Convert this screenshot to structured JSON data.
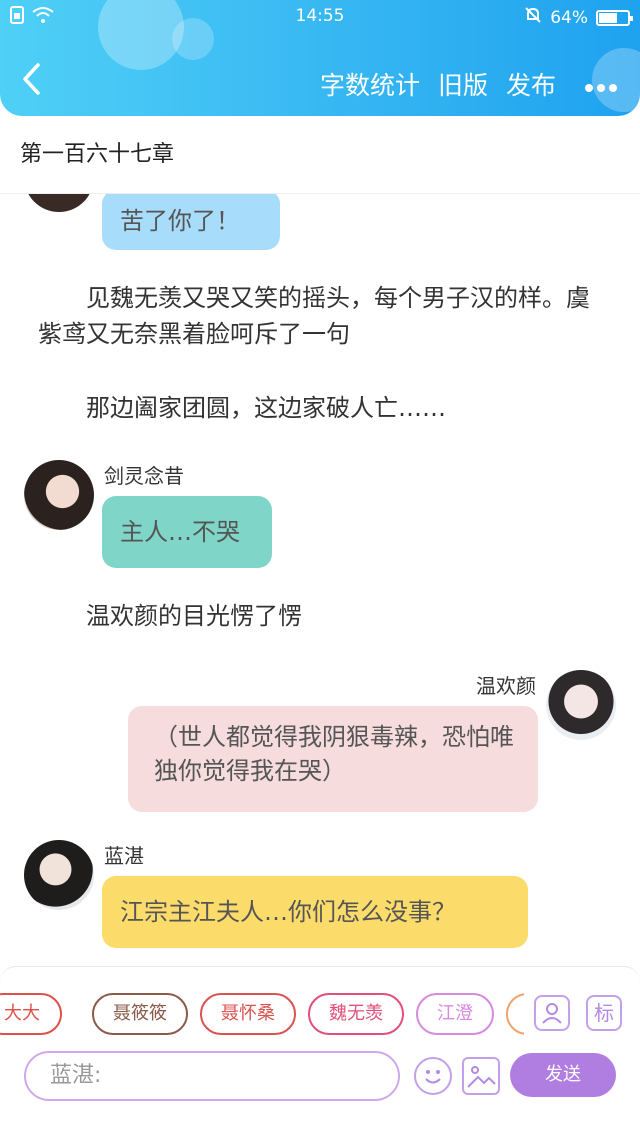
{
  "status_bar": {
    "time": "14:55",
    "battery": "64%",
    "battery_level": 0.64,
    "icons": [
      "sim-icon",
      "wifi-icon",
      "mute-bell-icon",
      "battery-icon"
    ]
  },
  "nav": {
    "back_icon": "chevron-left-icon",
    "word_count": "字数统计",
    "old_version": "旧版",
    "publish": "发布",
    "more_icon": "more-dots-icon"
  },
  "chapter": {
    "title": "第一百六十七章"
  },
  "messages": [
    {
      "type": "bubble",
      "side": "left",
      "speaker": "",
      "text": "苦了你了！",
      "color": "#a8dcfb"
    },
    {
      "type": "narration",
      "text": "见魏无羡又哭又笑的摇头，每个男子汉的样。虞紫鸢又无奈黑着脸呵斥了一句"
    },
    {
      "type": "narration",
      "text": "那边阖家团圆，这边家破人亡……"
    },
    {
      "type": "bubble",
      "side": "left",
      "speaker": "剑灵念昔",
      "text": "主人…不哭",
      "color": "#7fd6c8"
    },
    {
      "type": "narration",
      "text": "温欢颜的目光愣了愣"
    },
    {
      "type": "bubble",
      "side": "right",
      "speaker": "温欢颜",
      "text": "（世人都觉得我阴狠毒辣，恐怕唯独你觉得我在哭）",
      "color": "#f6dcdc"
    },
    {
      "type": "bubble",
      "side": "left",
      "speaker": "蓝湛",
      "text": "江宗主江夫人…你们怎么没事？",
      "color": "#fbdb6a"
    }
  ],
  "toolbar": {
    "chips": [
      {
        "label": "大大",
        "color": "#e0504a"
      },
      {
        "label": "聂筱筱",
        "color": "#8b5a4a"
      },
      {
        "label": "聂怀桑",
        "color": "#d9534f"
      },
      {
        "label": "魏无羡",
        "color": "#e0507a"
      },
      {
        "label": "江澄",
        "color": "#d88adf"
      }
    ],
    "role_icon": "person-card-icon",
    "mark_label": "标",
    "input_placeholder": "蓝湛:",
    "emoji_icon": "smiley-icon",
    "image_icon": "image-icon",
    "send_label": "发送"
  }
}
